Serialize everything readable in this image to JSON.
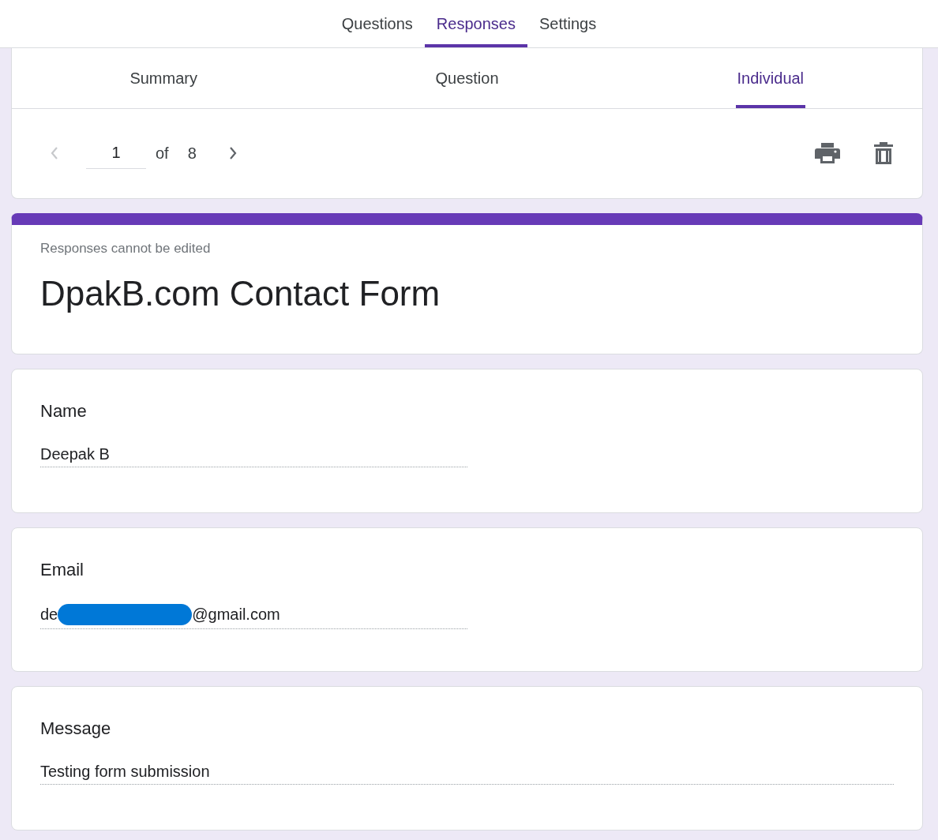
{
  "top_tabs": [
    {
      "label": "Questions",
      "selected": false
    },
    {
      "label": "Responses",
      "selected": true
    },
    {
      "label": "Settings",
      "selected": false
    }
  ],
  "view_tabs": [
    {
      "label": "Summary",
      "selected": false
    },
    {
      "label": "Question",
      "selected": false
    },
    {
      "label": "Individual",
      "selected": true
    }
  ],
  "pager": {
    "previous_disabled": true,
    "current": "1",
    "of_label": "of",
    "total": "8"
  },
  "form": {
    "notice": "Responses cannot be edited",
    "title": "DpakB.com Contact Form"
  },
  "questions": [
    {
      "label": "Name",
      "kind": "short",
      "answer": {
        "text": "Deepak B"
      }
    },
    {
      "label": "Email",
      "kind": "short",
      "answer": {
        "text": "de",
        "redacted": true,
        "after": "@gmail.com"
      }
    },
    {
      "label": "Message",
      "kind": "paragraph",
      "answer": {
        "text": "Testing form submission"
      }
    }
  ]
}
